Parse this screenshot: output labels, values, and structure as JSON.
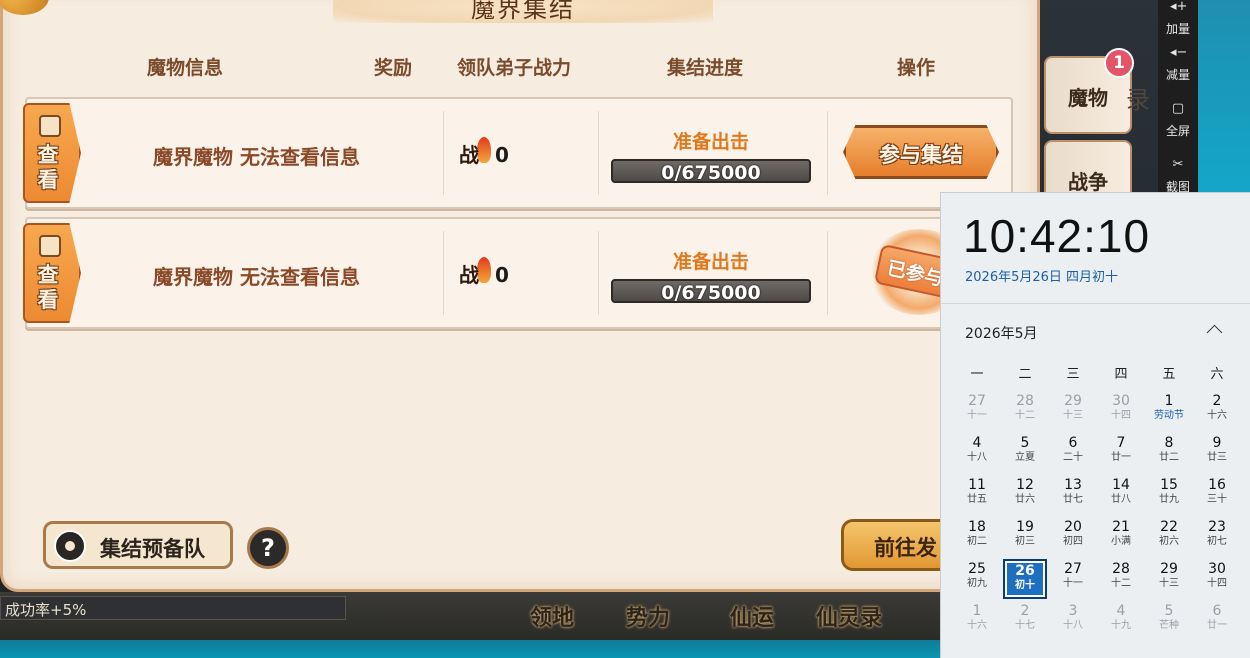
{
  "game": {
    "panel_title": "魔界集结",
    "headers": [
      "魔物信息",
      "奖励",
      "领队弟子战力",
      "集结进度",
      "操作"
    ],
    "rows": [
      {
        "view_label": "查看",
        "monster_info": "魔界魔物 无法查看信息",
        "power_char": "战",
        "power_value": "0",
        "status": "准备出击",
        "progress_text": "0/675000",
        "progress_fraction": 0,
        "action": "参与集结"
      },
      {
        "view_label": "查看",
        "monster_info": "魔界魔物 无法查看信息",
        "power_char": "战",
        "power_value": "0",
        "status": "准备出击",
        "progress_text": "0/675000",
        "progress_fraction": 0,
        "action": "已参与"
      }
    ],
    "reserve_button": "集结预备队",
    "help_button": "?",
    "goto_button": "前往发",
    "side_tabs": [
      {
        "label": "魔物",
        "badge": "1"
      },
      {
        "label": "战争"
      }
    ],
    "side_ghost_text": "录",
    "success_text": "成功率+5%",
    "bottom_nav": [
      "领地",
      "势力",
      "仙运",
      "仙灵录"
    ]
  },
  "toolbar": [
    {
      "icon": "volume-up-icon",
      "label": "加量"
    },
    {
      "icon": "volume-down-icon",
      "label": "减量"
    },
    {
      "icon": "fullscreen-icon",
      "label": "全屏"
    },
    {
      "icon": "scissors-icon",
      "label": "截图"
    }
  ],
  "calendar": {
    "time": "10:42:10",
    "date_line": "2026年5月26日 四月初十",
    "month_label": "2026年5月",
    "weekdays": [
      "一",
      "二",
      "三",
      "四",
      "五",
      "六"
    ],
    "weeks": [
      [
        {
          "d": "27",
          "l": "十一",
          "out": true
        },
        {
          "d": "28",
          "l": "十二",
          "out": true
        },
        {
          "d": "29",
          "l": "十三",
          "out": true
        },
        {
          "d": "30",
          "l": "十四",
          "out": true
        },
        {
          "d": "1",
          "l": "劳动节",
          "holiday": true
        },
        {
          "d": "2",
          "l": "十六"
        }
      ],
      [
        {
          "d": "4",
          "l": "十八"
        },
        {
          "d": "5",
          "l": "立夏"
        },
        {
          "d": "6",
          "l": "二十"
        },
        {
          "d": "7",
          "l": "廿一"
        },
        {
          "d": "8",
          "l": "廿二"
        },
        {
          "d": "9",
          "l": "廿三"
        }
      ],
      [
        {
          "d": "11",
          "l": "廿五"
        },
        {
          "d": "12",
          "l": "廿六"
        },
        {
          "d": "13",
          "l": "廿七"
        },
        {
          "d": "14",
          "l": "廿八"
        },
        {
          "d": "15",
          "l": "廿九"
        },
        {
          "d": "16",
          "l": "三十"
        }
      ],
      [
        {
          "d": "18",
          "l": "初二"
        },
        {
          "d": "19",
          "l": "初三"
        },
        {
          "d": "20",
          "l": "初四"
        },
        {
          "d": "21",
          "l": "小满"
        },
        {
          "d": "22",
          "l": "初六"
        },
        {
          "d": "23",
          "l": "初七"
        }
      ],
      [
        {
          "d": "25",
          "l": "初九"
        },
        {
          "d": "26",
          "l": "初十",
          "today": true
        },
        {
          "d": "27",
          "l": "十一"
        },
        {
          "d": "28",
          "l": "十二"
        },
        {
          "d": "29",
          "l": "十三"
        },
        {
          "d": "30",
          "l": "十四"
        }
      ],
      [
        {
          "d": "1",
          "l": "十六",
          "out": true
        },
        {
          "d": "2",
          "l": "十七",
          "out": true
        },
        {
          "d": "3",
          "l": "十八",
          "out": true
        },
        {
          "d": "4",
          "l": "十九",
          "out": true
        },
        {
          "d": "5",
          "l": "芒种",
          "out": true
        },
        {
          "d": "6",
          "l": "廿一",
          "out": true
        }
      ]
    ]
  },
  "colors": {
    "accent_orange": "#e0781e",
    "calendar_today": "#1f6fc0",
    "date_link": "#1a5fa8"
  }
}
